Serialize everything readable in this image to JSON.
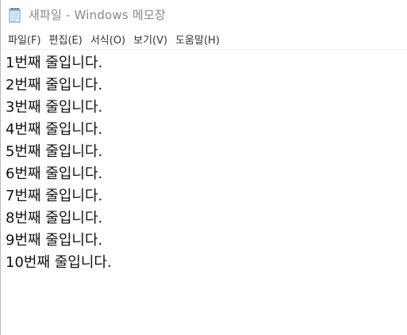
{
  "window": {
    "title": "새파일 - Windows 메모장",
    "icon": "notepad-icon"
  },
  "menu": {
    "items": [
      {
        "label": "파일(F)"
      },
      {
        "label": "편집(E)"
      },
      {
        "label": "서식(O)"
      },
      {
        "label": "보기(V)"
      },
      {
        "label": "도움말(H)"
      }
    ]
  },
  "editor": {
    "lines": [
      "1번째 줄입니다.",
      "2번째 줄입니다.",
      "3번째 줄입니다.",
      "4번째 줄입니다.",
      "5번째 줄입니다.",
      "6번째 줄입니다.",
      "7번째 줄입니다.",
      "8번째 줄입니다.",
      "9번째 줄입니다.",
      "10번째 줄입니다."
    ]
  }
}
